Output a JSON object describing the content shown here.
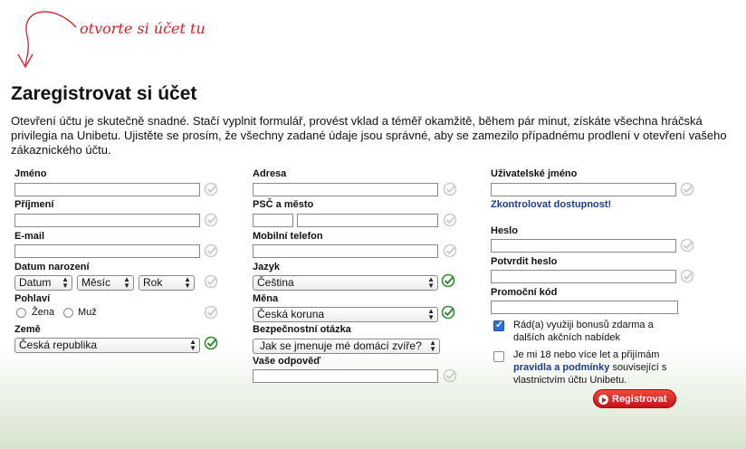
{
  "hint": {
    "text": "otvorte si účet tu"
  },
  "page": {
    "title": "Zaregistrovat si účet",
    "intro": "Otevření účtu je skutečně snadné. Stačí vyplnit formulář, provést vklad a téměř okamžitě, během pár minut, získáte všechna hráčská privilegia na Unibetu. Ujistěte se prosím, že všechny zadané údaje jsou správné, aby se zamezilo případnému prodlení v otevření vašeho zákaznického účtu."
  },
  "left": {
    "first_name_label": "Jméno",
    "last_name_label": "Příjmení",
    "email_label": "E-mail",
    "dob_label": "Datum narození",
    "dob_day": "Datum",
    "dob_month": "Měsíc",
    "dob_year": "Rok",
    "gender_label": "Pohlaví",
    "gender_female": "Žena",
    "gender_male": "Muž",
    "country_label": "Země",
    "country_value": "Česká republika"
  },
  "middle": {
    "address_label": "Adresa",
    "zip_city_label": "PSČ a město",
    "mobile_label": "Mobilní telefon",
    "language_label": "Jazyk",
    "language_value": "Čeština",
    "currency_label": "Měna",
    "currency_value": "Česká koruna",
    "security_q_label": "Bezpečnostní otázka",
    "security_q_value": "Jak se jmenuje mé domácí zvíře?",
    "answer_label": "Vaše odpověď"
  },
  "right": {
    "username_label": "Uživatelské jméno",
    "check_availability": "Zkontrolovat dostupnost!",
    "password_label": "Heslo",
    "confirm_password_label": "Potvrdit heslo",
    "promo_label": "Promoční kód",
    "bonus_text": "Rád(a) využiji bonusů zdarma a dalších akčních nabídek",
    "age_text_1": "Je mi 18 nebo více let a přijímám",
    "terms_link": "pravidla a podmínky",
    "age_text_2": "související s vlastnictvím účtu Unibetu.",
    "bonus_checked": true,
    "age_checked": false,
    "register_button": "Registrovat"
  },
  "colors": {
    "accent_red": "#d2232a",
    "link_blue": "#1e3d8f",
    "valid_gray": "#c9cec9",
    "valid_green": "#2e8b2e"
  }
}
